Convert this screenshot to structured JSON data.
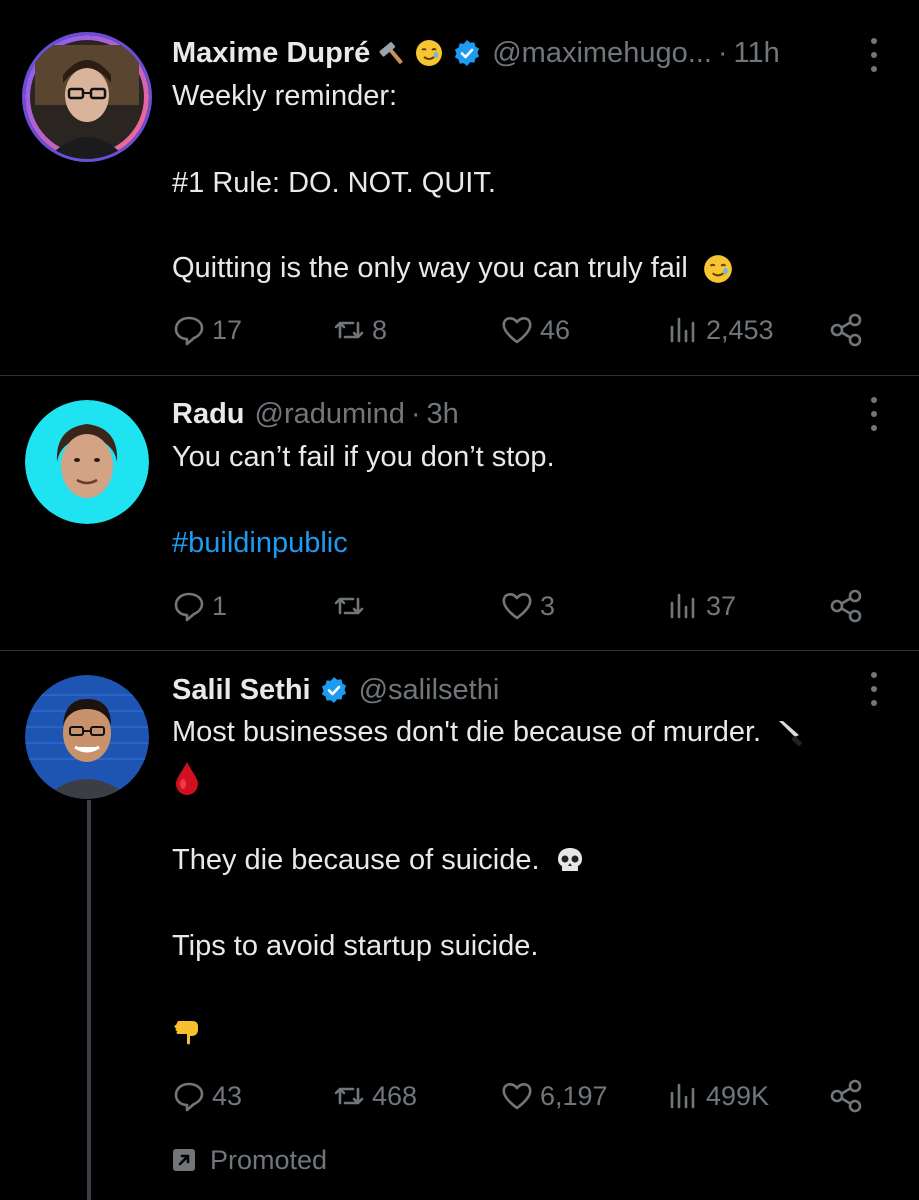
{
  "colors": {
    "background": "#000000",
    "text": "#e7e9ea",
    "muted": "#71767b",
    "link": "#1d9bf0",
    "divider": "#2f3336",
    "verified": "#1d9bf0"
  },
  "tweets": [
    {
      "name": "Maxime Dupré",
      "name_emojis": [
        "hammer-emoji",
        "smiling-face-with-tear-emoji"
      ],
      "verified": true,
      "handle": "@maximehugo...",
      "dot": "·",
      "time": "11h",
      "lines": [
        "Weekly reminder:",
        "#1 Rule: DO. NOT. QUIT.",
        "Quitting is the only way you can truly fail"
      ],
      "replies": "17",
      "reposts": "8",
      "likes": "46",
      "views": "2,453"
    },
    {
      "name": "Radu",
      "verified": false,
      "handle": "@radumind",
      "dot": "·",
      "time": "3h",
      "lines": [
        "You can’t fail if you don’t stop.",
        "#buildinpublic"
      ],
      "replies": "1",
      "reposts": "",
      "likes": "3",
      "views": "37"
    },
    {
      "name": "Salil Sethi",
      "verified": true,
      "handle": "@salilsethi",
      "lines": [
        "Most businesses don't die because of murder.",
        "They die because of suicide.",
        "Tips to avoid startup suicide."
      ],
      "replies": "43",
      "reposts": "468",
      "likes": "6,197",
      "views": "499K",
      "promoted": "Promoted"
    }
  ]
}
